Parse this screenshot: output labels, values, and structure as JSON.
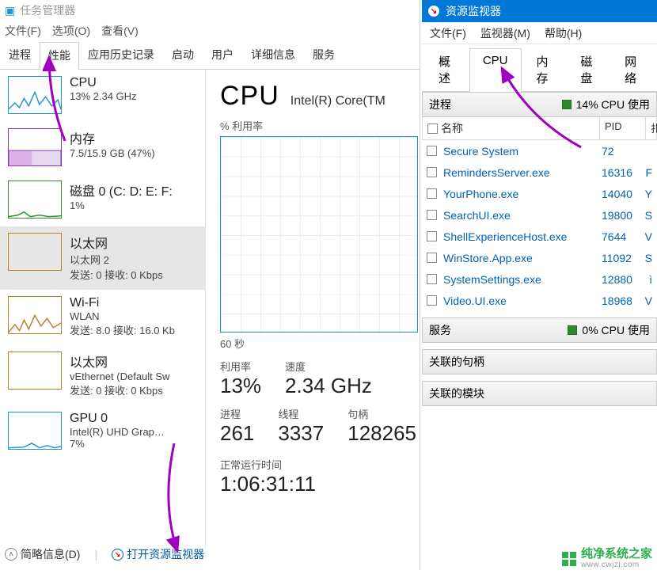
{
  "task_manager": {
    "title": "任务管理器",
    "menu": {
      "file": "文件(F)",
      "options": "选项(O)",
      "view": "查看(V)"
    },
    "tabs": [
      "进程",
      "性能",
      "应用历史记录",
      "启动",
      "用户",
      "详细信息",
      "服务"
    ],
    "active_tab": "性能",
    "sidebar": [
      {
        "name": "CPU",
        "line1": "13%  2.34 GHz",
        "line2": "",
        "kind": "cpu"
      },
      {
        "name": "内存",
        "line1": "7.5/15.9 GB (47%)",
        "line2": "",
        "kind": "mem"
      },
      {
        "name": "磁盘 0 (C: D: E: F:",
        "line1": "1%",
        "line2": "",
        "kind": "disk"
      },
      {
        "name": "以太网",
        "line1": "以太网 2",
        "line2": "发送: 0 接收: 0 Kbps",
        "kind": "eth"
      },
      {
        "name": "Wi-Fi",
        "line1": "WLAN",
        "line2": "发送: 8.0 接收: 16.0 Kb",
        "kind": "wifi"
      },
      {
        "name": "以太网",
        "line1": "vEthernet (Default Sw",
        "line2": "发送: 0 接收: 0 Kbps",
        "kind": "eth"
      },
      {
        "name": "GPU 0",
        "line1": "Intel(R) UHD Grap…",
        "line2": "7%",
        "kind": "gpu"
      }
    ],
    "sidebar_active": 3,
    "graph": {
      "title": "CPU",
      "subtitle": "Intel(R) Core(TM",
      "axis_label": "% 利用率",
      "duration": "60 秒",
      "stats": {
        "util_label": "利用率",
        "util_value": "13%",
        "speed_label": "速度",
        "speed_value": "2.34 GHz",
        "proc_label": "进程",
        "proc_value": "261",
        "thread_label": "线程",
        "thread_value": "3337",
        "handle_label": "句柄",
        "handle_value": "128265"
      },
      "uptime_label": "正常运行时间",
      "uptime_value": "1:06:31:11"
    },
    "footer": {
      "less": "简略信息(D)",
      "open_rm": "打开资源监视器"
    }
  },
  "resource_monitor": {
    "title": "资源监视器",
    "menu": {
      "file": "文件(F)",
      "monitor": "监视器(M)",
      "help": "帮助(H)"
    },
    "tabs": [
      "概述",
      "CPU",
      "内存",
      "磁盘",
      "网络"
    ],
    "active_tab": "CPU",
    "sections": {
      "processes": {
        "label": "进程",
        "badge": "14% CPU 使用"
      },
      "services": {
        "label": "服务",
        "badge": "0% CPU 使用"
      },
      "handles": {
        "label": "关联的句柄"
      },
      "modules": {
        "label": "关联的模块"
      }
    },
    "columns": {
      "name": "名称",
      "pid": "PID",
      "extra": "扎"
    },
    "rows": [
      {
        "name": "Secure System",
        "pid": "72",
        "extra": ""
      },
      {
        "name": "RemindersServer.exe",
        "pid": "16316",
        "extra": "F"
      },
      {
        "name": "YourPhone.exe",
        "pid": "14040",
        "extra": "Y"
      },
      {
        "name": "SearchUI.exe",
        "pid": "19800",
        "extra": "S"
      },
      {
        "name": "ShellExperienceHost.exe",
        "pid": "7644",
        "extra": "V"
      },
      {
        "name": "WinStore.App.exe",
        "pid": "11092",
        "extra": "S"
      },
      {
        "name": "SystemSettings.exe",
        "pid": "12880",
        "extra": "ì"
      },
      {
        "name": "Video.UI.exe",
        "pid": "18968",
        "extra": "V"
      }
    ]
  },
  "watermark": {
    "brand": "纯净系统之家",
    "url": "www.cwjzj.com"
  }
}
